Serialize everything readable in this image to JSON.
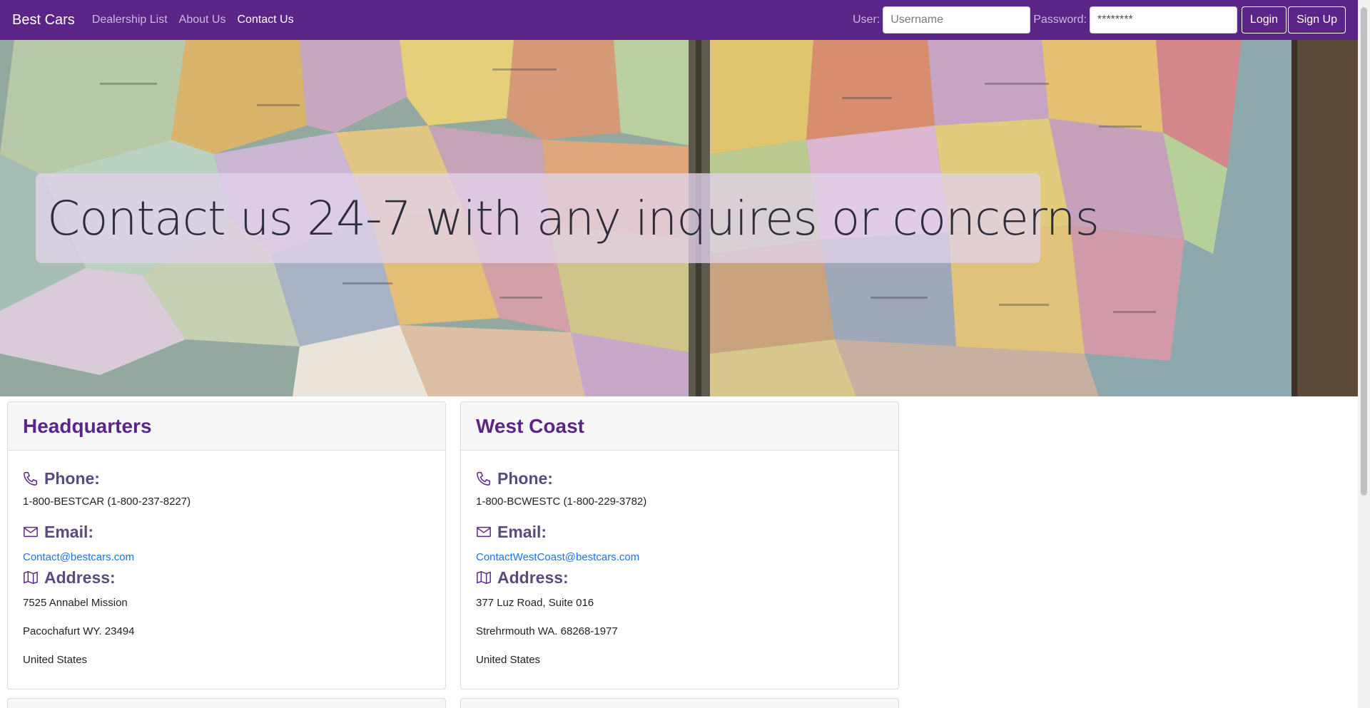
{
  "nav": {
    "brand": "Best Cars",
    "links": [
      {
        "label": "Dealership List",
        "active": false
      },
      {
        "label": "About Us",
        "active": false
      },
      {
        "label": "Contact Us",
        "active": true
      }
    ],
    "user_label": "User:",
    "username_placeholder": "Username",
    "password_label": "Password:",
    "password_value": "********",
    "login_label": "Login",
    "signup_label": "Sign Up"
  },
  "hero": {
    "headline": "Contact us 24-7 with any inquires or concerns"
  },
  "offices": [
    {
      "name": "Headquarters",
      "phone_heading": "Phone:",
      "phone": "1-800-BESTCAR (1-800-237-8227)",
      "email_heading": "Email:",
      "email": "Contact@bestcars.com",
      "address_heading": "Address:",
      "address_lines": [
        "7525 Annabel Mission",
        "Pacochafurt WY. 23494",
        "United States"
      ]
    },
    {
      "name": "West Coast",
      "phone_heading": "Phone:",
      "phone": "1-800-BCWESTC (1-800-229-3782)",
      "email_heading": "Email:",
      "email": "ContactWestCoast@bestcars.com",
      "address_heading": "Address:",
      "address_lines": [
        "377 Luz Road, Suite 016",
        "Strehrmouth WA. 68268-1977",
        "United States"
      ]
    }
  ],
  "icons": {
    "phone": "phone-icon",
    "email": "envelope-icon",
    "address": "map-icon"
  },
  "colors": {
    "brand_purple": "#5b2587",
    "link_blue": "#1a73e8"
  }
}
